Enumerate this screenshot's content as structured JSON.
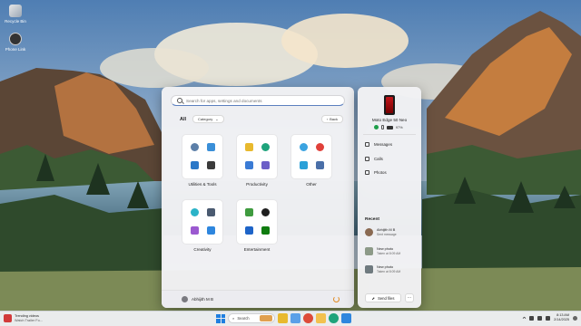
{
  "desktop": {
    "icons": [
      {
        "label": "Recycle Bin"
      },
      {
        "label": "Phone Link"
      }
    ]
  },
  "start_menu": {
    "search_placeholder": "Search for apps, settings and documents",
    "all_label": "All",
    "category_label": "Category",
    "back_label": "Back",
    "groups": [
      {
        "label": "Utilities & Tools"
      },
      {
        "label": "Productivity"
      },
      {
        "label": "Other"
      },
      {
        "label": "Creativity"
      },
      {
        "label": "Entertainment"
      }
    ],
    "user_name": "Abhijith M B"
  },
  "phone_panel": {
    "device_name": "Moto Edge 50 Neo",
    "battery": "97%",
    "menu": [
      "Messages",
      "Calls",
      "Photos"
    ],
    "recent_title": "Recent",
    "recent": [
      {
        "title": "Abhijith M B",
        "subtitle": "Sent message"
      },
      {
        "title": "New photo",
        "subtitle": "Taken at 8:09 AM"
      },
      {
        "title": "New photo",
        "subtitle": "Taken at 8:09 AM"
      }
    ],
    "send_files": "Send files",
    "more": "..."
  },
  "taskbar": {
    "weather_title": "Trending videos",
    "weather_sub": "Watch Trailer Fo...",
    "search_label": "Search",
    "time": "8:13 AM",
    "date": "2/14/2025"
  },
  "colors": {
    "accent": "#1f7fe0",
    "phone_red": "#c0151b",
    "status_green": "#1e9e4a"
  }
}
